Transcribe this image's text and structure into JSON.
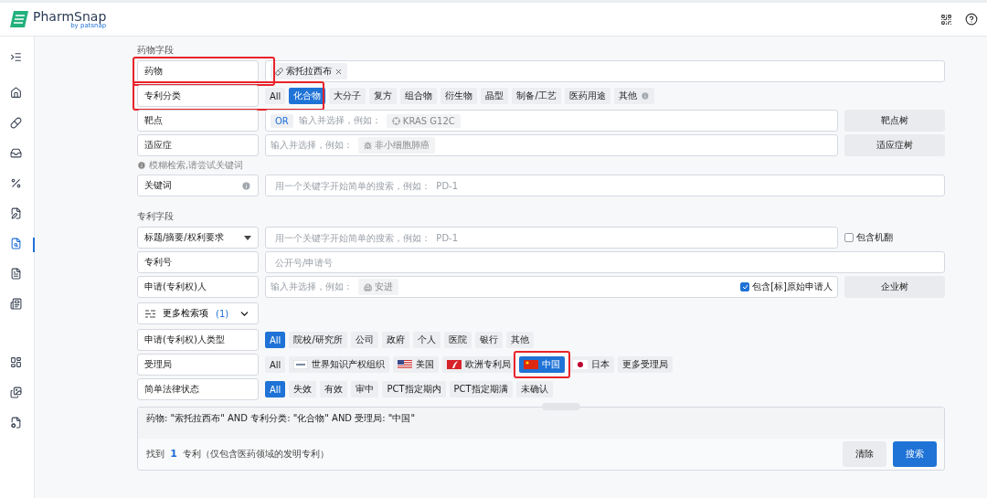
{
  "header": {
    "logo": "PharmSnap",
    "logo_by": "by",
    "logo_sub": "patsnap"
  },
  "sidebar": {
    "items": [
      {
        "kind": "menu",
        "selected": false
      },
      {
        "kind": "home",
        "selected": false
      },
      {
        "kind": "pill",
        "selected": false
      },
      {
        "kind": "tray",
        "selected": false
      },
      {
        "kind": "percent",
        "selected": false
      },
      {
        "kind": "file-edit",
        "selected": false
      },
      {
        "kind": "file-search",
        "selected": true
      },
      {
        "kind": "file",
        "selected": false
      },
      {
        "kind": "newspaper",
        "selected": false
      },
      {
        "kind": "layout",
        "selected": false
      },
      {
        "kind": "images",
        "selected": false
      },
      {
        "kind": "file-cog",
        "selected": false
      }
    ]
  },
  "drug_section": {
    "title": "药物字段",
    "rows": [
      {
        "kind": "tags",
        "label": "药物",
        "highlighted": true,
        "tags": [
          "索托拉西布"
        ]
      },
      {
        "kind": "chips",
        "label": "专利分类",
        "highlighted": true,
        "chips": [
          {
            "label": "All",
            "selected": false
          },
          {
            "label": "化合物",
            "selected": true
          },
          {
            "label": "大分子",
            "selected": false
          },
          {
            "label": "复方",
            "selected": false
          },
          {
            "label": "组合物",
            "selected": false
          },
          {
            "label": "衍生物",
            "selected": false
          },
          {
            "label": "晶型",
            "selected": false
          },
          {
            "label": "制备/工艺",
            "selected": false
          },
          {
            "label": "医药用途",
            "selected": false
          },
          {
            "label": "其他",
            "selected": false,
            "info": true
          }
        ]
      },
      {
        "kind": "search",
        "label": "靶点",
        "operator": "OR",
        "placeholder": "输入并选择，例如：",
        "example": {
          "kind": "target",
          "label": "KRAS G12C"
        },
        "button": "靶点树"
      },
      {
        "kind": "search",
        "label": "适应症",
        "placeholder": "输入并选择，例如：",
        "example": {
          "kind": "disease",
          "label": "非小细胞肺癌"
        },
        "button": "适应症树"
      },
      {
        "kind": "hint",
        "text": "模糊检索,请尝试关键词"
      },
      {
        "kind": "text",
        "label": "关键词",
        "label_info": true,
        "placeholder": "用一个关键字开始简单的搜索，例如：  PD-1"
      }
    ]
  },
  "patent_section": {
    "title": "专利字段",
    "rows": [
      {
        "kind": "text",
        "label": "标题/摘要/权利要求",
        "dropdown": true,
        "placeholder": "用一个关键字开始简单的搜索，例如：  PD-1",
        "checkbox": {
          "label": "包含机翻",
          "checked": false
        }
      },
      {
        "kind": "text",
        "label": "专利号",
        "placeholder": "公开号/申请号"
      },
      {
        "kind": "search",
        "label": "申请(专利权)人",
        "placeholder": "输入并选择，例如：",
        "example": {
          "kind": "company",
          "label": "安进"
        },
        "inner_checkbox": {
          "label": "包含[标]原始申请人",
          "checked": true
        },
        "button": "企业树"
      }
    ]
  },
  "more": {
    "label": "更多检索项",
    "count": "(1)",
    "expanded": true
  },
  "more_rows": [
    {
      "kind": "chips",
      "label": "申请(专利权)人类型",
      "chips": [
        {
          "label": "All",
          "selected": true
        },
        {
          "label": "院校/研究所",
          "selected": false
        },
        {
          "label": "公司",
          "selected": false
        },
        {
          "label": "政府",
          "selected": false
        },
        {
          "label": "个人",
          "selected": false
        },
        {
          "label": "医院",
          "selected": false
        },
        {
          "label": "银行",
          "selected": false
        },
        {
          "label": "其他",
          "selected": false
        }
      ]
    },
    {
      "kind": "chips",
      "label": "受理局",
      "chips": [
        {
          "label": "All",
          "selected": false
        },
        {
          "label": "世界知识产权组织",
          "selected": false,
          "kind": "wipo"
        },
        {
          "label": "美国",
          "selected": false,
          "kind": "us"
        },
        {
          "label": "欧洲专利局",
          "selected": false,
          "kind": "ep"
        },
        {
          "label": "中国",
          "selected": true,
          "kind": "cn",
          "highlighted": true
        },
        {
          "label": "日本",
          "selected": false,
          "kind": "jp"
        },
        {
          "label": "更多受理局",
          "selected": false
        }
      ]
    },
    {
      "kind": "chips",
      "label": "简单法律状态",
      "chips": [
        {
          "label": "All",
          "selected": true
        },
        {
          "label": "失效",
          "selected": false
        },
        {
          "label": "有效",
          "selected": false
        },
        {
          "label": "审中",
          "selected": false
        },
        {
          "label": "PCT指定期内",
          "selected": false
        },
        {
          "label": "PCT指定期满",
          "selected": false
        },
        {
          "label": "未确认",
          "selected": false
        }
      ]
    }
  ],
  "query": {
    "text": "药物: \"索托拉西布\" AND 专利分类: \"化合物\" AND 受理局: \"中国\"",
    "result": "找到 **1** 专利（仅包含医药领域的发明专利）",
    "buttons": [
      {
        "label": "清除",
        "kind": "secondary"
      },
      {
        "label": "搜索",
        "kind": "primary"
      }
    ]
  }
}
